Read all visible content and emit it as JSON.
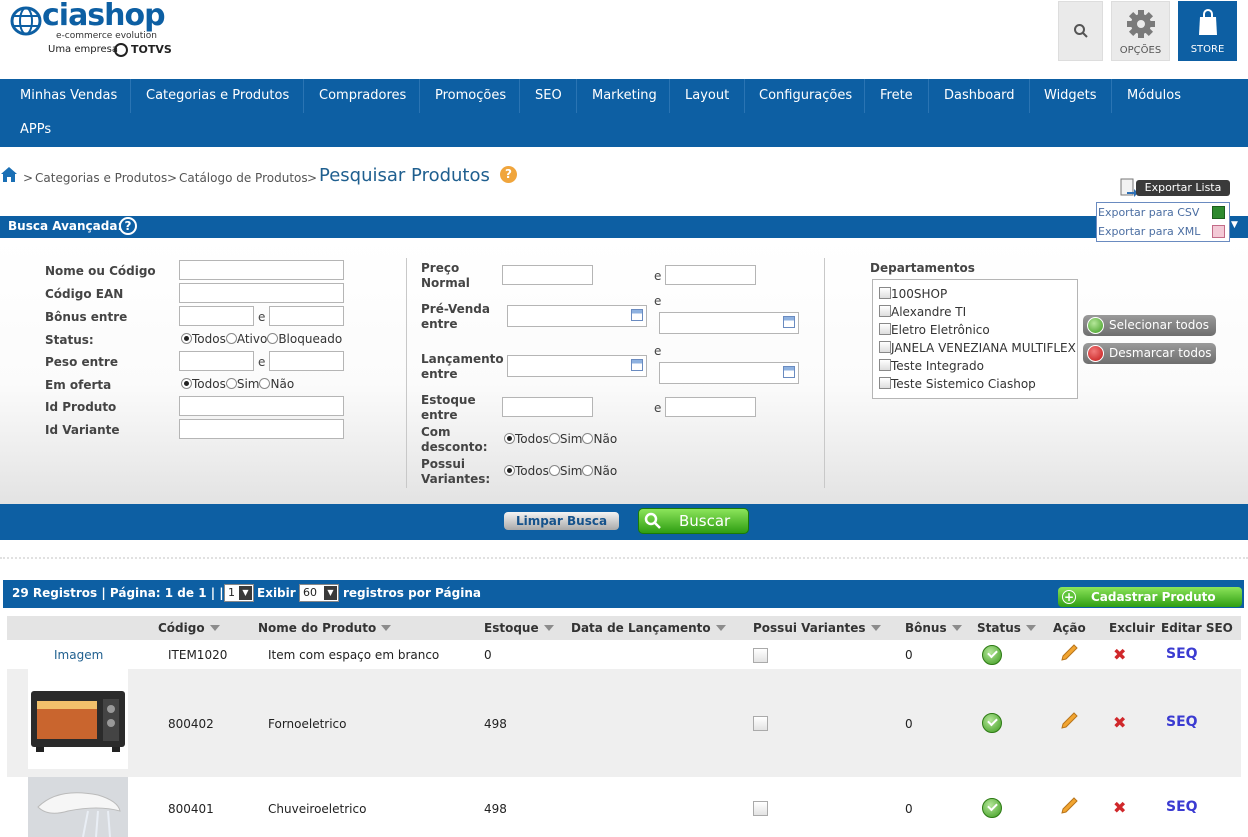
{
  "header": {
    "logo_text": "ciashop",
    "logo_tagline": "e-commerce evolution",
    "logo_company": "Uma empresa",
    "logo_brand": "TOTVS",
    "options_label": "OPÇÕES",
    "store_label": "STORE"
  },
  "nav": {
    "items": [
      "Minhas Vendas",
      "Categorias e Produtos",
      "Compradores",
      "Promoções",
      "SEO",
      "Marketing",
      "Layout",
      "Configurações",
      "Frete",
      "Dashboard",
      "Widgets",
      "Módulos",
      "APPs"
    ]
  },
  "breadcrumb": {
    "items": [
      "Categorias e Produtos",
      "Catálogo de Produtos"
    ],
    "separator": ">",
    "title": "Pesquisar Produtos"
  },
  "export": {
    "button_label": "Exportar Lista",
    "options": [
      "Exportar para CSV",
      "Exportar para XML"
    ]
  },
  "search": {
    "title": "Busca Avançada:",
    "name_label": "Nome ou Código",
    "ean_label": "Código EAN",
    "bonus_label": "Bônus entre",
    "status_label": "Status:",
    "status_options": [
      "Todos",
      "Ativo",
      "Bloqueado"
    ],
    "weight_label": "Peso entre",
    "offer_label": "Em oferta",
    "yes_no_options": [
      "Todos",
      "Sim",
      "Não"
    ],
    "product_id_label": "Id Produto",
    "variant_id_label": "Id Variante",
    "price_label_1": "Preço",
    "price_label_2": "Normal",
    "presale_label_1": "Pré-Venda",
    "presale_label_2": "entre",
    "launch_label_1": "Lançamento",
    "launch_label_2": "entre",
    "stock_label_1": "Estoque",
    "stock_label_2": "entre",
    "discount_label_1": "Com",
    "discount_label_2": "desconto:",
    "variants_label_1": "Possui",
    "variants_label_2": "Variantes:",
    "range_sep": "e",
    "departments_label": "Departamentos",
    "departments": [
      "100SHOP",
      "Alexandre TI",
      "Eletro Eletrônico",
      "JANELA VENEZIANA MULTIFLEX",
      "Teste Integrado",
      "Teste Sistemico Ciashop"
    ],
    "select_all_label": "Selecionar todos",
    "deselect_all_label": "Desmarcar todos",
    "clear_label": "Limpar Busca",
    "search_label": "Buscar"
  },
  "results": {
    "summary": "29 Registros | Página: 1 de 1 | |",
    "page_value": "1",
    "show_label": "Exibir",
    "per_page_value": "60",
    "per_page_label": "registros por Página",
    "create_label": "Cadastrar Produto"
  },
  "table": {
    "columns": [
      "Código",
      "Nome do Produto",
      "Estoque",
      "Data de Lançamento",
      "Possui Variantes",
      "Bônus",
      "Status",
      "Ação",
      "Excluir",
      "Editar SEO"
    ],
    "rows": [
      {
        "image": "Imagem",
        "code": "ITEM1020",
        "name": "Item com espaço em branco",
        "stock": "0",
        "launch": "",
        "bonus": "0",
        "seo": "SEQ"
      },
      {
        "image": "",
        "code": "800402",
        "name": "Fornoeletrico",
        "stock": "498",
        "launch": "",
        "bonus": "0",
        "seo": "SEQ"
      },
      {
        "image": "",
        "code": "800401",
        "name": "Chuveiroeletrico",
        "stock": "498",
        "launch": "",
        "bonus": "0",
        "seo": "SEQ"
      }
    ]
  },
  "colors": {
    "primary_blue": "#0d5fa3",
    "accent_green": "#3fae1c",
    "title_blue": "#1f5f8f"
  }
}
